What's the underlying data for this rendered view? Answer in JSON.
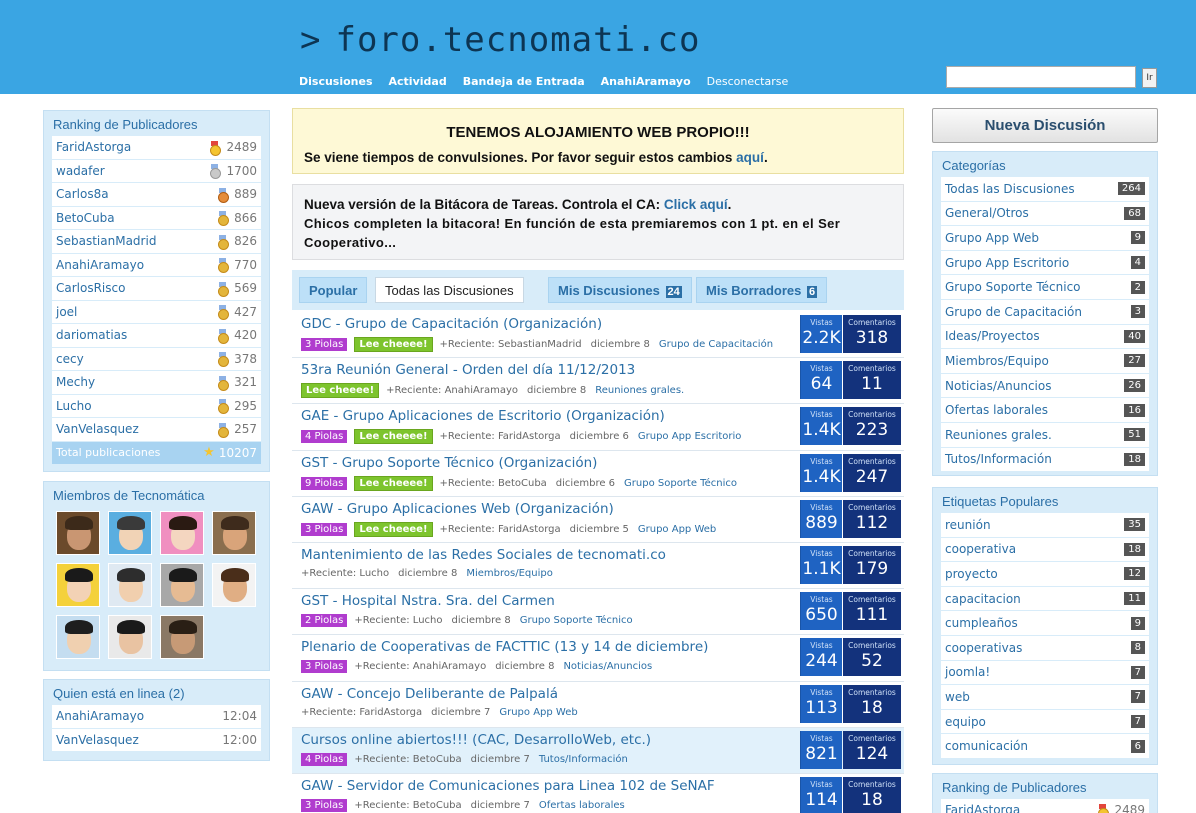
{
  "header": {
    "logo": "foro.tecnomati.co",
    "logo_prompt": ">",
    "nav": [
      "Discusiones",
      "Actividad",
      "Bandeja de Entrada",
      "AnahiAramayo",
      "Desconectarse"
    ],
    "search_button": "Ir"
  },
  "ranking": {
    "title": "Ranking de Publicadores",
    "rows": [
      {
        "name": "FaridAstorga",
        "value": "2489",
        "medal": "m1"
      },
      {
        "name": "wadafer",
        "value": "1700",
        "medal": "m2"
      },
      {
        "name": "Carlos8a",
        "value": "889",
        "medal": "m3"
      },
      {
        "name": "BetoCuba",
        "value": "866",
        "medal": "m"
      },
      {
        "name": "SebastianMadrid",
        "value": "826",
        "medal": "m"
      },
      {
        "name": "AnahiAramayo",
        "value": "770",
        "medal": "m"
      },
      {
        "name": "CarlosRisco",
        "value": "569",
        "medal": "m"
      },
      {
        "name": "joel",
        "value": "427",
        "medal": "m"
      },
      {
        "name": "dariomatias",
        "value": "420",
        "medal": "m"
      },
      {
        "name": "cecy",
        "value": "378",
        "medal": "m"
      },
      {
        "name": "Mechy",
        "value": "321",
        "medal": "m"
      },
      {
        "name": "Lucho",
        "value": "295",
        "medal": "m"
      },
      {
        "name": "VanVelasquez",
        "value": "257",
        "medal": "m"
      }
    ],
    "total_label": "Total publicaciones",
    "total_value": "10207"
  },
  "members": {
    "title": "Miembros de Tecnomática"
  },
  "online": {
    "title": "Quien está en linea (2)",
    "rows": [
      {
        "name": "AnahiAramayo",
        "time": "12:04"
      },
      {
        "name": "VanVelasquez",
        "time": "12:00"
      }
    ]
  },
  "notice1": {
    "title": "TENEMOS ALOJAMIENTO WEB PROPIO!!!",
    "text": "Se viene tiempos de convulsiones. Por favor seguir estos cambios",
    "link": "aquí",
    "end": "."
  },
  "notice2": {
    "text": "Nueva versión de la Bitácora de Tareas. Controla el CA:",
    "link": "Click aquí",
    "end": ".",
    "line2": "Chicos completen la bitacora! En función de esta premiaremos con 1 pt. en el Ser",
    "line3": "Cooperativo..."
  },
  "tabs": [
    {
      "label": "Popular",
      "count": ""
    },
    {
      "label": "Todas las Discusiones",
      "count": ""
    },
    {
      "label": "Mis Discusiones",
      "count": "24"
    },
    {
      "label": "Mis Borradores",
      "count": "6"
    }
  ],
  "stat_labels": {
    "views": "Vistas",
    "comments": "Comentarios"
  },
  "discussions": [
    {
      "title": "GDC - Grupo de Capacitación (Organización)",
      "piolas": "3 Piolas",
      "cheee": "Lee cheeee!",
      "recent": "+Reciente: SebastianMadrid",
      "date": "diciembre 8",
      "category": "Grupo de Capacitación",
      "views": "2.2K",
      "comments": "318"
    },
    {
      "title": "53ra Reunión General - Orden del día 11/12/2013",
      "piolas": "",
      "cheee": "Lee cheeee!",
      "recent": "+Reciente: AnahiAramayo",
      "date": "diciembre 8",
      "category": "Reuniones grales.",
      "views": "64",
      "comments": "11"
    },
    {
      "title": "GAE - Grupo Aplicaciones de Escritorio (Organización)",
      "piolas": "4 Piolas",
      "cheee": "Lee cheeee!",
      "recent": "+Reciente: FaridAstorga",
      "date": "diciembre 6",
      "category": "Grupo App Escritorio",
      "views": "1.4K",
      "comments": "223"
    },
    {
      "title": "GST - Grupo Soporte Técnico (Organización)",
      "piolas": "9 Piolas",
      "cheee": "Lee cheeee!",
      "recent": "+Reciente: BetoCuba",
      "date": "diciembre 6",
      "category": "Grupo Soporte Técnico",
      "views": "1.4K",
      "comments": "247"
    },
    {
      "title": "GAW - Grupo Aplicaciones Web (Organización)",
      "piolas": "3 Piolas",
      "cheee": "Lee cheeee!",
      "recent": "+Reciente: FaridAstorga",
      "date": "diciembre 5",
      "category": "Grupo App Web",
      "views": "889",
      "comments": "112"
    },
    {
      "title": "Mantenimiento de las Redes Sociales de tecnomati.co",
      "piolas": "",
      "cheee": "",
      "recent": "+Reciente: Lucho",
      "date": "diciembre 8",
      "category": "Miembros/Equipo",
      "views": "1.1K",
      "comments": "179"
    },
    {
      "title": "GST - Hospital Nstra. Sra. del Carmen",
      "piolas": "2 Piolas",
      "cheee": "",
      "recent": "+Reciente: Lucho",
      "date": "diciembre 8",
      "category": "Grupo Soporte Técnico",
      "views": "650",
      "comments": "111"
    },
    {
      "title": "Plenario de Cooperativas de FACTTIC (13 y 14 de diciembre)",
      "piolas": "3 Piolas",
      "cheee": "",
      "recent": "+Reciente: AnahiAramayo",
      "date": "diciembre 8",
      "category": "Noticias/Anuncios",
      "views": "244",
      "comments": "52"
    },
    {
      "title": "GAW - Concejo Deliberante de Palpalá",
      "piolas": "",
      "cheee": "",
      "recent": "+Reciente: FaridAstorga",
      "date": "diciembre 7",
      "category": "Grupo App Web",
      "views": "113",
      "comments": "18"
    },
    {
      "title": "Cursos online abiertos!!! (CAC, DesarrolloWeb, etc.)",
      "piolas": "4 Piolas",
      "cheee": "",
      "recent": "+Reciente: BetoCuba",
      "date": "diciembre 7",
      "category": "Tutos/Información",
      "views": "821",
      "comments": "124",
      "highlight": true
    },
    {
      "title": "GAW - Servidor de Comunicaciones para Linea 102 de SeNAF",
      "piolas": "3 Piolas",
      "cheee": "",
      "recent": "+Reciente: BetoCuba",
      "date": "diciembre 7",
      "category": "Ofertas laborales",
      "views": "114",
      "comments": "18"
    }
  ],
  "new_discussion": "Nueva Discusión",
  "categories": {
    "title": "Categorías",
    "rows": [
      {
        "name": "Todas las Discusiones",
        "count": "264"
      },
      {
        "name": "General/Otros",
        "count": "68"
      },
      {
        "name": "Grupo App Web",
        "count": "9"
      },
      {
        "name": "Grupo App Escritorio",
        "count": "4"
      },
      {
        "name": "Grupo Soporte Técnico",
        "count": "2"
      },
      {
        "name": "Grupo de Capacitación",
        "count": "3"
      },
      {
        "name": "Ideas/Proyectos",
        "count": "40"
      },
      {
        "name": "Miembros/Equipo",
        "count": "27"
      },
      {
        "name": "Noticias/Anuncios",
        "count": "26"
      },
      {
        "name": "Ofertas laborales",
        "count": "16"
      },
      {
        "name": "Reuniones grales.",
        "count": "51"
      },
      {
        "name": "Tutos/Información",
        "count": "18"
      }
    ]
  },
  "tags": {
    "title": "Etiquetas Populares",
    "rows": [
      {
        "name": "reunión",
        "count": "35"
      },
      {
        "name": "cooperativa",
        "count": "18"
      },
      {
        "name": "proyecto",
        "count": "12"
      },
      {
        "name": "capacitacion",
        "count": "11"
      },
      {
        "name": "cumpleaños",
        "count": "9"
      },
      {
        "name": "cooperativas",
        "count": "8"
      },
      {
        "name": "joomla!",
        "count": "7"
      },
      {
        "name": "web",
        "count": "7"
      },
      {
        "name": "equipo",
        "count": "7"
      },
      {
        "name": "comunicación",
        "count": "6"
      }
    ]
  },
  "ranking2": {
    "title": "Ranking de Publicadores",
    "first_name": "FaridAstorga",
    "first_value": "2489"
  },
  "colors": {
    "header": "#3aa5e3",
    "panel": "#d8ecf9",
    "link": "#2b6fa6",
    "piolas": "#b03cce",
    "cheee": "#7dc42d",
    "views": "#1f63c2",
    "comments": "#13327c"
  }
}
